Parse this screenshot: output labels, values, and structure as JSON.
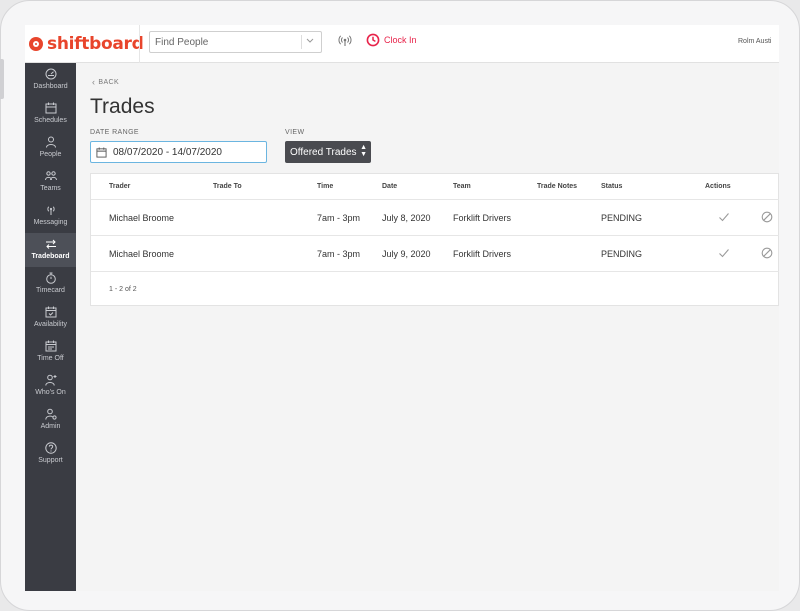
{
  "app": {
    "brand": "shiftboard"
  },
  "header": {
    "search_placeholder": "Find People",
    "clock_in_label": "Clock In",
    "user_name": "Rolm Austi"
  },
  "sidebar": {
    "items": [
      {
        "label": "Dashboard",
        "icon": "dashboard-icon"
      },
      {
        "label": "Schedules",
        "icon": "calendar-icon"
      },
      {
        "label": "People",
        "icon": "person-icon"
      },
      {
        "label": "Teams",
        "icon": "teams-icon"
      },
      {
        "label": "Messaging",
        "icon": "broadcast-icon"
      },
      {
        "label": "Tradeboard",
        "icon": "swap-arrows-icon",
        "active": true
      },
      {
        "label": "Timecard",
        "icon": "stopwatch-icon"
      },
      {
        "label": "Availability",
        "icon": "calendar-check-icon"
      },
      {
        "label": "Time Off",
        "icon": "calendar-icon"
      },
      {
        "label": "Who's On",
        "icon": "person-plus-icon"
      },
      {
        "label": "Admin",
        "icon": "person-gear-icon"
      },
      {
        "label": "Support",
        "icon": "help-icon"
      }
    ]
  },
  "page": {
    "back_label": "BACK",
    "title": "Trades",
    "date_range_label": "DATE RANGE",
    "date_range_value": "08/07/2020 - 14/07/2020",
    "view_label": "VIEW",
    "view_value": "Offered Trades"
  },
  "table": {
    "columns": [
      "Trader",
      "Trade To",
      "Time",
      "Date",
      "Team",
      "Trade Notes",
      "Status",
      "Actions"
    ],
    "rows": [
      {
        "trader": "Michael Broome",
        "trade_to": "",
        "time": "7am - 3pm",
        "date": "July 8, 2020",
        "team": "Forklift Drivers",
        "notes": "",
        "status": "PENDING"
      },
      {
        "trader": "Michael Broome",
        "trade_to": "",
        "time": "7am - 3pm",
        "date": "July 9, 2020",
        "team": "Forklift Drivers",
        "notes": "",
        "status": "PENDING"
      }
    ],
    "pagination": "1 - 2 of 2"
  },
  "colors": {
    "brand": "#e8452c",
    "clock_in": "#e8234a",
    "sidebar_bg": "#3a3c43",
    "date_border": "#6bb5e0",
    "view_bg": "#4a4b50"
  }
}
